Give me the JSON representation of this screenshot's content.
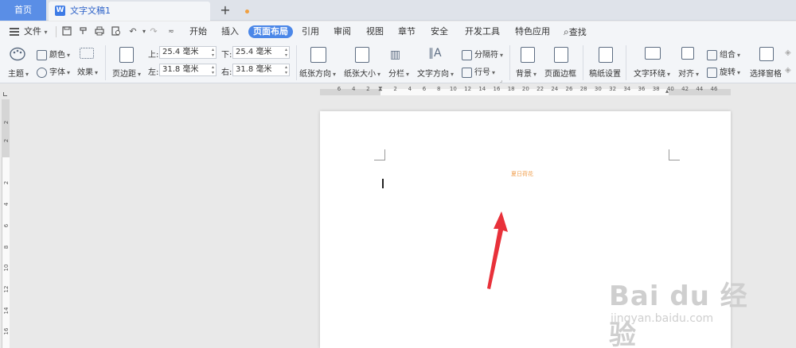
{
  "tabs": {
    "home_label": "首页",
    "doc_label": "文字文稿1",
    "doc_icon_letter": "W",
    "add_label": "+"
  },
  "menu": {
    "file_label": "文件",
    "items": [
      "开始",
      "插入",
      "页面布局",
      "引用",
      "审阅",
      "视图",
      "章节",
      "安全",
      "开发工具",
      "特色应用"
    ],
    "active_item": "页面布局",
    "search_label": "查找"
  },
  "ribbon": {
    "theme_label": "主题",
    "color_label": "颜色",
    "font_label": "字体",
    "effect_label": "效果",
    "margin_label": "页边距",
    "top_label": "上:",
    "top_value": "25.4 毫米",
    "bottom_label": "下:",
    "bottom_value": "25.4 毫米",
    "left_label": "左:",
    "left_value": "31.8 毫米",
    "right_label": "右:",
    "right_value": "31.8 毫米",
    "orientation_label": "纸张方向",
    "size_label": "纸张大小",
    "columns_label": "分栏",
    "text_dir_label": "文字方向",
    "break_label": "分隔符",
    "line_num_label": "行号",
    "background_label": "背景",
    "border_label": "页面边框",
    "grid_paper_label": "稿纸设置",
    "wrap_label": "文字环绕",
    "align_label": "对齐",
    "group_label": "组合",
    "rotate_label": "旋转",
    "select_pane_label": "选择窗格"
  },
  "ruler": {
    "h_ticks": [
      "6",
      "4",
      "2",
      "2",
      "4",
      "6",
      "8",
      "10",
      "12",
      "14",
      "16",
      "18",
      "20",
      "22",
      "24",
      "26",
      "28",
      "30",
      "32",
      "34",
      "36",
      "38",
      "40",
      "42",
      "44",
      "46"
    ],
    "v_ticks": [
      "2",
      "2",
      "2",
      "4",
      "6",
      "8",
      "10",
      "12",
      "14",
      "16"
    ]
  },
  "document": {
    "header_text": "夏日荷花"
  },
  "watermark": {
    "logo_text": "Bai du 经验",
    "url_text": "jingyan.baidu.com"
  },
  "colors": {
    "accent": "#4b87e8",
    "home_tab": "#5a8ee6",
    "arrow": "#e8313a"
  }
}
